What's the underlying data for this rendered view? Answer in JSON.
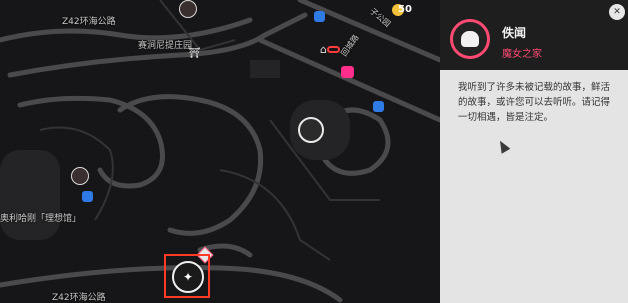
{
  "map": {
    "labels": {
      "road_top_left": "Z42环海公路",
      "manor": "赛涧尼提庄园",
      "road_bottom": "Z42环海公路",
      "venue": "奥利哈刚「理想馆」",
      "street_diag": "回城路",
      "street_right": "子公园"
    },
    "counter": "50",
    "icons": {
      "top_pin": "npc-pin-icon",
      "manor_gate": "gate-icon",
      "building": "building-icon",
      "chain": "chain-icon",
      "pink_mask": "mask-icon",
      "witch_pin": "witch-pin-icon",
      "blue_marker": "fast-travel-icon",
      "left_pin": "npc-pin-icon",
      "diamond": "waypoint-icon",
      "selected": "selected-npc-icon",
      "star": "star-icon"
    }
  },
  "panel": {
    "npc_name": "佚闻",
    "npc_subtitle": "魔女之家",
    "description": "我听到了许多未被记载的故事，鲜活的故事，或许您可以去听听。请记得一切相遇，皆是注定。",
    "close_icon": "close-icon",
    "avatar_icon": "witch-avatar-icon"
  },
  "colors": {
    "accent": "#ff4a72",
    "selection": "#ff3a26",
    "map_bg": "#161618",
    "panel_bg": "#e4e4e4"
  }
}
